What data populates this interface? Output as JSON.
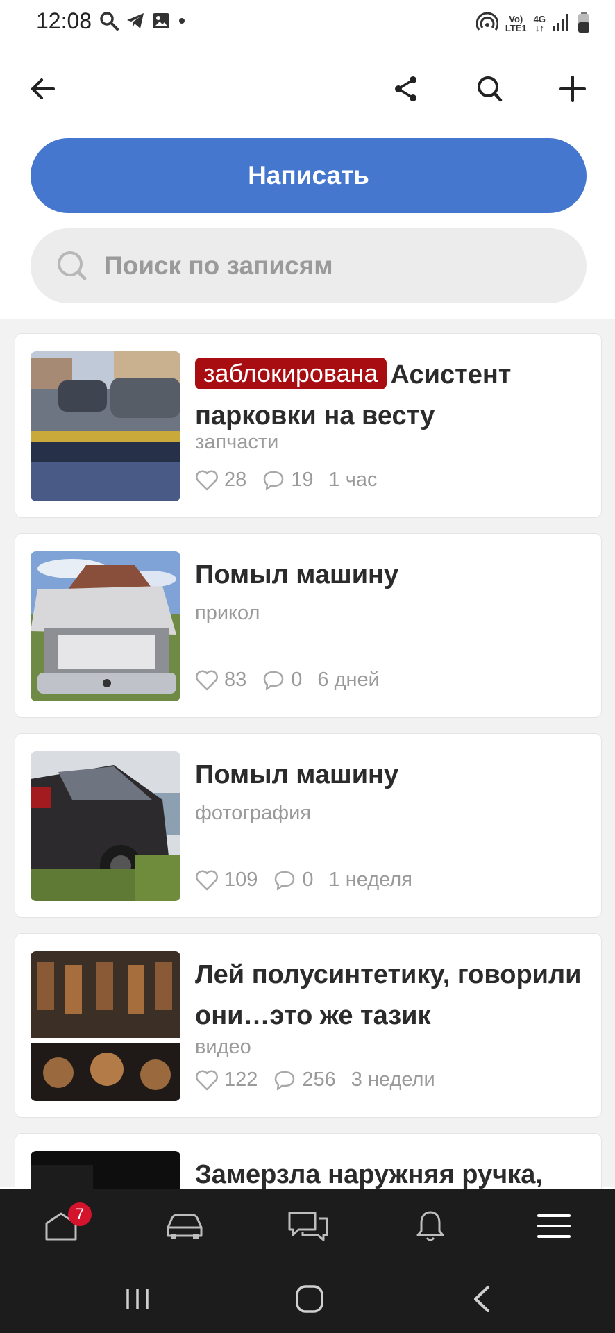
{
  "status_bar": {
    "time": "12:08",
    "network_top": "Vo)",
    "network_bottom": "LTE1",
    "signal_label_top": "4G",
    "signal_label_bottom": "↓↑",
    "left_icons": [
      "search-icon",
      "telegram-icon",
      "gallery-icon",
      "dot-icon"
    ],
    "right_icons": [
      "hotspot-icon",
      "volte-icon",
      "4g-icon",
      "signal-icon",
      "battery-icon"
    ]
  },
  "toolbar": {
    "back_icon": "arrow-left-icon",
    "share_icon": "share-icon",
    "search_icon": "search-icon",
    "add_icon": "plus-icon"
  },
  "write_button": {
    "label": "Написать",
    "color": "#4677cf"
  },
  "search": {
    "placeholder": "Поиск по записям"
  },
  "posts": [
    {
      "badge": "заблокирована",
      "title": "Асистент парковки на весту",
      "category": "запчасти",
      "likes": "28",
      "comments": "19",
      "time": "1 час"
    },
    {
      "badge": "",
      "title": "Помыл машину",
      "category": "прикол",
      "likes": "83",
      "comments": "0",
      "time": "6 дней"
    },
    {
      "badge": "",
      "title": "Помыл машину",
      "category": "фотография",
      "likes": "109",
      "comments": "0",
      "time": "1 неделя"
    },
    {
      "badge": "",
      "title": "Лей полусинтетику, говорили они…это же тазик",
      "category": "видео",
      "likes": "122",
      "comments": "256",
      "time": "3 недели"
    },
    {
      "badge": "",
      "title": "Замерзла наружняя ручка,",
      "category": "",
      "likes": "",
      "comments": "",
      "time": ""
    }
  ],
  "bottom_nav": {
    "home_badge": "7",
    "items": [
      "home-icon",
      "car-icon",
      "chat-icon",
      "bell-icon",
      "menu-icon"
    ]
  },
  "system_nav": {
    "items": [
      "recents-icon",
      "home-circle-icon",
      "back-chevron-icon"
    ]
  },
  "colors": {
    "accent": "#4677cf",
    "badge": "#a80d12",
    "nav_badge": "#d4142c",
    "nav_bg": "#1c1c1c"
  }
}
